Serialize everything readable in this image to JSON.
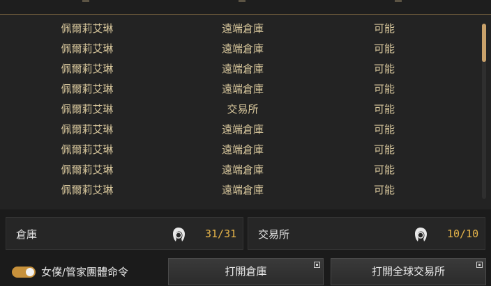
{
  "table": {
    "rows": [
      {
        "name": "佩爾莉艾琳",
        "location": "遠端倉庫",
        "status": "可能"
      },
      {
        "name": "佩爾莉艾琳",
        "location": "遠端倉庫",
        "status": "可能"
      },
      {
        "name": "佩爾莉艾琳",
        "location": "遠端倉庫",
        "status": "可能"
      },
      {
        "name": "佩爾莉艾琳",
        "location": "遠端倉庫",
        "status": "可能"
      },
      {
        "name": "佩爾莉艾琳",
        "location": "交易所",
        "status": "可能"
      },
      {
        "name": "佩爾莉艾琳",
        "location": "遠端倉庫",
        "status": "可能"
      },
      {
        "name": "佩爾莉艾琳",
        "location": "遠端倉庫",
        "status": "可能"
      },
      {
        "name": "佩爾莉艾琳",
        "location": "遠端倉庫",
        "status": "可能"
      },
      {
        "name": "佩爾莉艾琳",
        "location": "遠端倉庫",
        "status": "可能"
      }
    ]
  },
  "summary": {
    "warehouse": {
      "label": "倉庫",
      "count": "31/31",
      "icon": "maid-head-icon"
    },
    "exchange": {
      "label": "交易所",
      "count": "10/10",
      "icon": "maid-head-icon"
    }
  },
  "footer": {
    "toggle_label": "女僕/管家團體命令",
    "toggle_on": true,
    "open_warehouse_label": "打開倉庫",
    "open_exchange_label": "打開全球交易所"
  },
  "colors": {
    "row_text": "#d8c79c",
    "count_text": "#e8b64a",
    "accent": "#c7913b"
  }
}
